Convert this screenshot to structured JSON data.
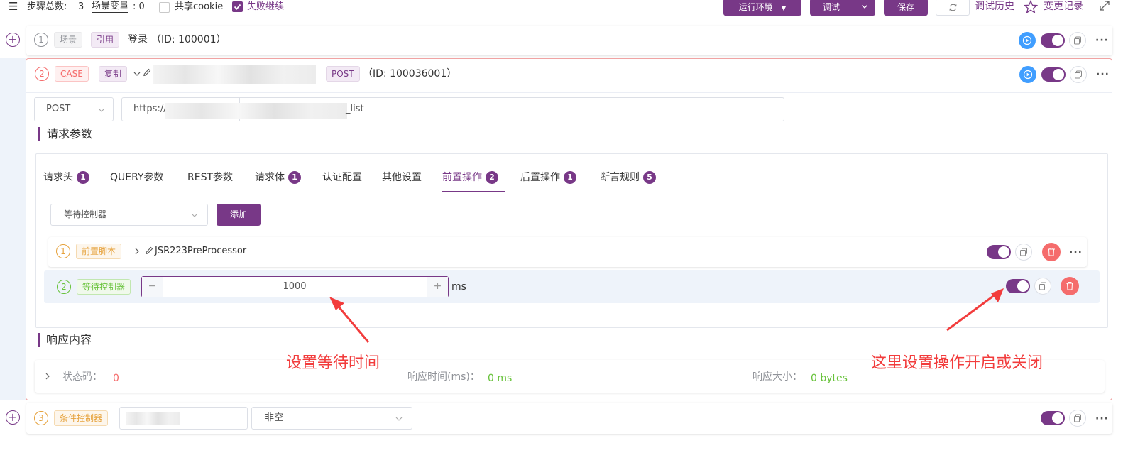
{
  "topbar": {
    "step_count_label": "步骤总数:",
    "step_count": "3",
    "scene_var_label": "场景变量",
    "scene_var_count": ": 0",
    "share_cookie": "共享cookie",
    "fail_continue": "失败继续",
    "env_button": "运行环境",
    "debug_button": "调试",
    "save_button": "保存",
    "debug_history": "调试历史",
    "change_log": "变更记录"
  },
  "step1": {
    "index": "1",
    "tag_scene": "场景",
    "tag_ref": "引用",
    "name": "登录",
    "id_text": "（ID: 100001）"
  },
  "step2": {
    "index": "2",
    "tag_case": "CASE",
    "tag_copy": "复制",
    "method_tag": "POST",
    "id_text": "（ID: 100036001）",
    "method_select": "POST",
    "url_prefix": "https://",
    "url_suffix": "_list",
    "request_params_title": "请求参数",
    "tabs": [
      {
        "label": "请求头",
        "badge": "1"
      },
      {
        "label": "QUERY参数",
        "badge": ""
      },
      {
        "label": "REST参数",
        "badge": ""
      },
      {
        "label": "请求体",
        "badge": "1"
      },
      {
        "label": "认证配置",
        "badge": ""
      },
      {
        "label": "其他设置",
        "badge": ""
      },
      {
        "label": "前置操作",
        "badge": "2"
      },
      {
        "label": "后置操作",
        "badge": "1"
      },
      {
        "label": "断言规则",
        "badge": "5"
      }
    ],
    "processor_select": "等待控制器",
    "add_button": "添加",
    "pre_items": [
      {
        "index": "1",
        "tag": "前置脚本",
        "name": "JSR223PreProcessor"
      },
      {
        "index": "2",
        "tag": "等待控制器",
        "wait_value": "1000",
        "unit": "ms"
      }
    ],
    "response_title": "响应内容",
    "status_code_label": "状态码：",
    "status_code": "0",
    "resp_time_label": "响应时间(ms)：",
    "resp_time": "0 ms",
    "resp_size_label": "响应大小：",
    "resp_size": "0 bytes"
  },
  "step3": {
    "index": "3",
    "tag": "条件控制器",
    "operator": "非空"
  },
  "annotations": {
    "wait_time_note": "设置等待时间",
    "toggle_note": "这里设置操作开启或关闭"
  },
  "colors": {
    "primary": "#783887",
    "danger": "#f56c6c",
    "success": "#67c23a",
    "warning": "#e6a23c",
    "annotation": "#f23c3c"
  }
}
